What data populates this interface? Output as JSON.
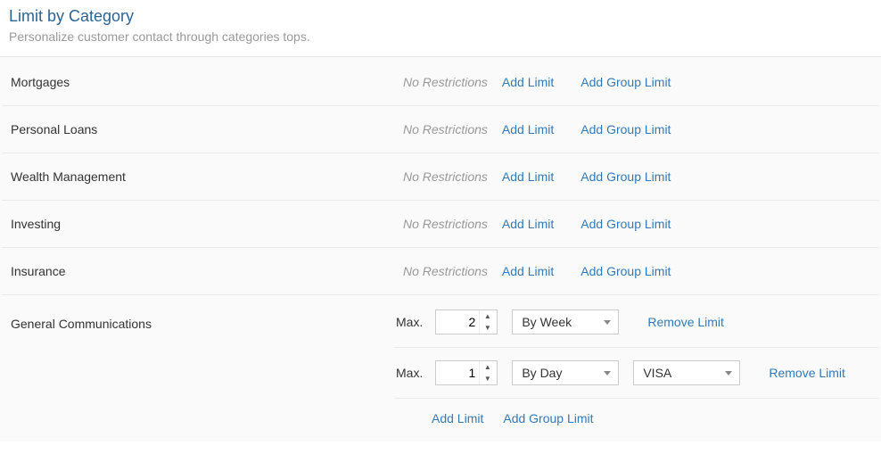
{
  "header": {
    "title": "Limit by Category",
    "subtitle": "Personalize customer contact through categories tops."
  },
  "labels": {
    "no_restrictions": "No Restrictions",
    "add_limit": "Add Limit",
    "add_group_limit": "Add Group Limit",
    "max": "Max.",
    "remove_limit": "Remove Limit"
  },
  "categories": {
    "0": {
      "name": "Mortgages"
    },
    "1": {
      "name": "Personal Loans"
    },
    "2": {
      "name": "Wealth Management"
    },
    "3": {
      "name": "Investing"
    },
    "4": {
      "name": "Insurance"
    }
  },
  "general": {
    "name": "General Communications",
    "limits": {
      "0": {
        "value": "2",
        "period": "By Week"
      },
      "1": {
        "value": "1",
        "period": "By Day",
        "group": "VISA"
      }
    }
  }
}
